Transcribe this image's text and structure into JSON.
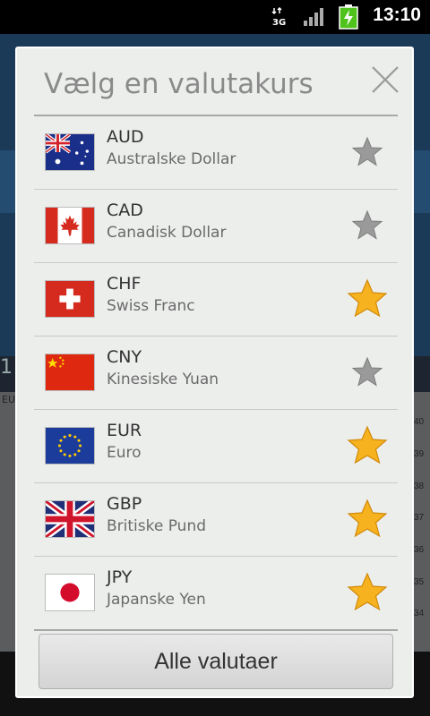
{
  "status_bar": {
    "time": "13:10",
    "network_label": "3G",
    "icons": [
      "3g-data-icon",
      "signal-icon",
      "battery-charging-icon"
    ]
  },
  "background": {
    "partial_text": "1",
    "partial_labels": [
      "EU"
    ],
    "axis_ticks": [
      "40",
      "39",
      "38",
      "37",
      "36",
      "35",
      "34"
    ]
  },
  "dialog": {
    "title": "Vælg en valutakurs",
    "close_icon": "close-icon",
    "currencies": [
      {
        "code": "AUD",
        "name": "Australske Dollar",
        "flag": "australia-flag-icon",
        "favorite": false
      },
      {
        "code": "CAD",
        "name": "Canadisk Dollar",
        "flag": "canada-flag-icon",
        "favorite": false
      },
      {
        "code": "CHF",
        "name": "Swiss Franc",
        "flag": "switzerland-flag-icon",
        "favorite": true
      },
      {
        "code": "CNY",
        "name": "Kinesiske Yuan",
        "flag": "china-flag-icon",
        "favorite": false
      },
      {
        "code": "EUR",
        "name": "Euro",
        "flag": "eu-flag-icon",
        "favorite": true
      },
      {
        "code": "GBP",
        "name": "Britiske Pund",
        "flag": "uk-flag-icon",
        "favorite": true
      },
      {
        "code": "JPY",
        "name": "Japanske Yen",
        "flag": "japan-flag-icon",
        "favorite": true
      }
    ],
    "button_label": "Alle valutaer"
  },
  "colors": {
    "star_on": "#f7b21f",
    "star_off": "#9a9a9a",
    "dialog_bg": "#eceeec"
  }
}
